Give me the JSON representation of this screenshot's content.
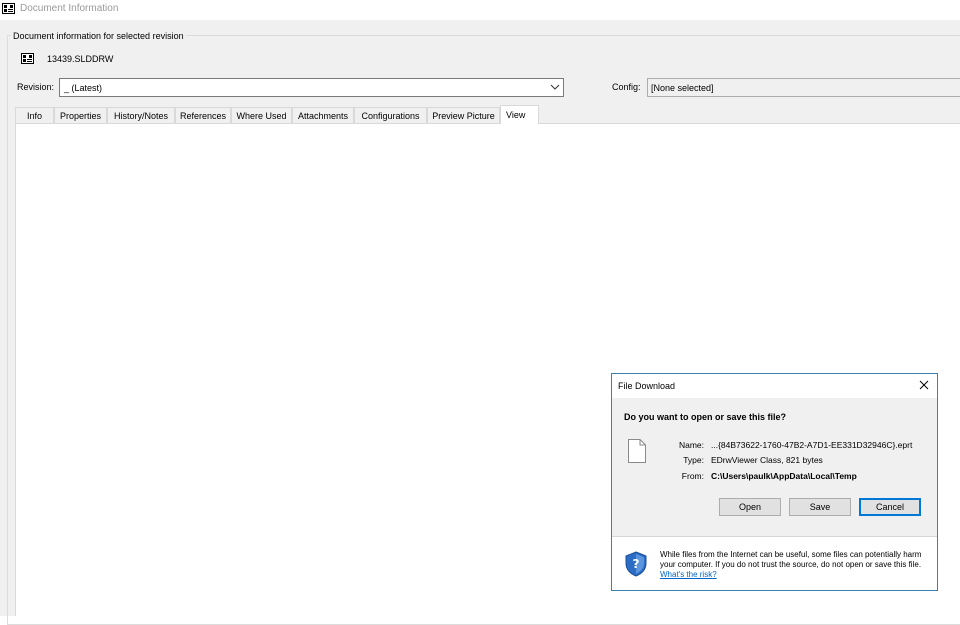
{
  "window": {
    "title": "Document Information"
  },
  "group": {
    "legend": "Document information for selected revision",
    "document_name": "13439.SLDDRW"
  },
  "revision": {
    "label": "Revision:",
    "value": "_ (Latest)"
  },
  "config": {
    "label": "Config:",
    "value": "[None selected]"
  },
  "tabs": [
    {
      "label": "Info",
      "active": false
    },
    {
      "label": "Properties",
      "active": false
    },
    {
      "label": "History/Notes",
      "active": false
    },
    {
      "label": "References",
      "active": false
    },
    {
      "label": "Where Used",
      "active": false
    },
    {
      "label": "Attachments",
      "active": false
    },
    {
      "label": "Configurations",
      "active": false
    },
    {
      "label": "Preview Picture",
      "active": false
    },
    {
      "label": "View",
      "active": true
    }
  ],
  "dialog": {
    "title": "File Download",
    "question": "Do you want to open or save this file?",
    "fields": {
      "name_label": "Name:",
      "name_value": "...{84B73622-1760-47B2-A7D1-EE331D32946C}.eprt",
      "type_label": "Type:",
      "type_value": "EDrwViewer Class, 821 bytes",
      "from_label": "From:",
      "from_value": "C:\\Users\\paulk\\AppData\\Local\\Temp"
    },
    "buttons": {
      "open": "Open",
      "save": "Save",
      "cancel": "Cancel"
    },
    "warning_text": "While files from the Internet can be useful, some files can potentially harm your computer. If you do not trust the source, do not open or save this file.",
    "warning_link": "What's the risk?"
  },
  "colors": {
    "accent": "#0078d7",
    "dialog_border": "#3c7fb1",
    "link": "#0066cc"
  },
  "icons": {
    "app": "document-info-icon",
    "doc": "drawing-file-icon",
    "file": "blank-file-icon",
    "shield": "shield-question-icon",
    "close": "close-icon",
    "dropdown": "chevron-down-icon"
  }
}
